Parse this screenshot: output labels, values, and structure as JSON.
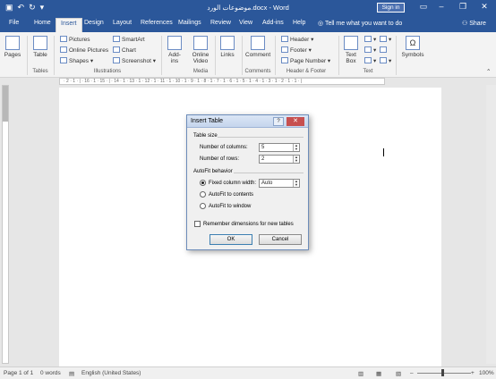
{
  "titlebar": {
    "title": "موضوعات الورد.docx - Word",
    "signin": "Sign in"
  },
  "tabs": [
    "File",
    "Home",
    "Insert",
    "Design",
    "Layout",
    "References",
    "Mailings",
    "Review",
    "View",
    "Add-ins",
    "Help"
  ],
  "active_tab": "Insert",
  "tellme": "Tell me what you want to do",
  "share": "Share",
  "ribbon": {
    "pages": "Pages",
    "table": "Table",
    "tables_group": "Tables",
    "pictures": "Pictures",
    "online_pictures": "Online Pictures",
    "shapes": "Shapes",
    "smartart": "SmartArt",
    "chart": "Chart",
    "screenshot": "Screenshot",
    "illustrations_group": "Illustrations",
    "addins": "Add-ins",
    "online_video": "Online Video",
    "media_group": "Media",
    "links": "Links",
    "comment": "Comment",
    "comments_group": "Comments",
    "header": "Header",
    "footer": "Footer",
    "page_number": "Page Number",
    "header_footer_group": "Header & Footer",
    "text_box": "Text Box",
    "text_group": "Text",
    "symbols": "Symbols"
  },
  "ruler": "· 2 · 1 · | · 16 · 1 · 15 · | · 14 · 1 · 13 · 1 · 12 · 1 · 11 · 1 · 10 · 1 · 9 · 1 · 8 · 1 · 7 · 1 · 6 · 1 · 5 · 1 · 4 · 1 · 3 · 1 · 2 · 1 · 1 · |",
  "dialog": {
    "title": "Insert Table",
    "table_size": "Table size",
    "num_columns_label": "Number of columns:",
    "num_columns": "5",
    "num_rows_label": "Number of rows:",
    "num_rows": "2",
    "autofit": "AutoFit behavior",
    "fixed_width_label": "Fixed column width:",
    "fixed_width_value": "Auto",
    "autofit_contents": "AutoFit to contents",
    "autofit_window": "AutoFit to window",
    "remember": "Remember dimensions for new tables",
    "ok": "OK",
    "cancel": "Cancel"
  },
  "status": {
    "page": "Page 1 of 1",
    "words": "0 words",
    "language": "English (United States)",
    "zoom": "100%"
  }
}
